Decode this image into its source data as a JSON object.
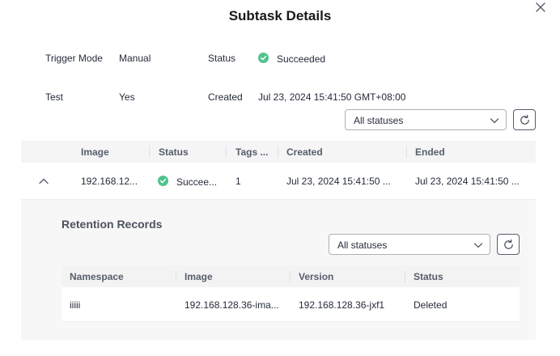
{
  "dialog": {
    "title": "Subtask Details",
    "info": {
      "trigger_mode_label": "Trigger Mode",
      "trigger_mode_value": "Manual",
      "status_label": "Status",
      "status_value": "Succeeded",
      "test_label": "Test",
      "test_value": "Yes",
      "created_label": "Created",
      "created_value": "Jul 23, 2024 15:41:50 GMT+08:00"
    }
  },
  "main_filter": {
    "selected": "All statuses"
  },
  "main_table": {
    "headers": [
      "Image",
      "Status",
      "Tags ...",
      "Created",
      "Ended"
    ],
    "row": {
      "image": "192.168.12...",
      "status": "Succee...",
      "tags": "1",
      "created": "Jul 23, 2024 15:41:50 ...",
      "ended": "Jul 23, 2024 15:41:50 ..."
    }
  },
  "retention": {
    "title": "Retention Records",
    "filter": {
      "selected": "All statuses"
    },
    "headers": [
      "Namespace",
      "Image",
      "Version",
      "Status"
    ],
    "row": {
      "namespace": "iiiii",
      "image": "192.168.128.36-ima...",
      "version": "192.168.128.36-jxf1",
      "status": "Deleted"
    }
  },
  "colors": {
    "success": "#50c28c",
    "header_bg": "#f5f5f6",
    "panel_bg": "#f7f7f7"
  },
  "icons": {
    "close": "close-icon",
    "success": "check-circle-icon",
    "chevron": "chevron-down-icon",
    "refresh": "refresh-icon",
    "collapse": "chevron-up-icon"
  }
}
